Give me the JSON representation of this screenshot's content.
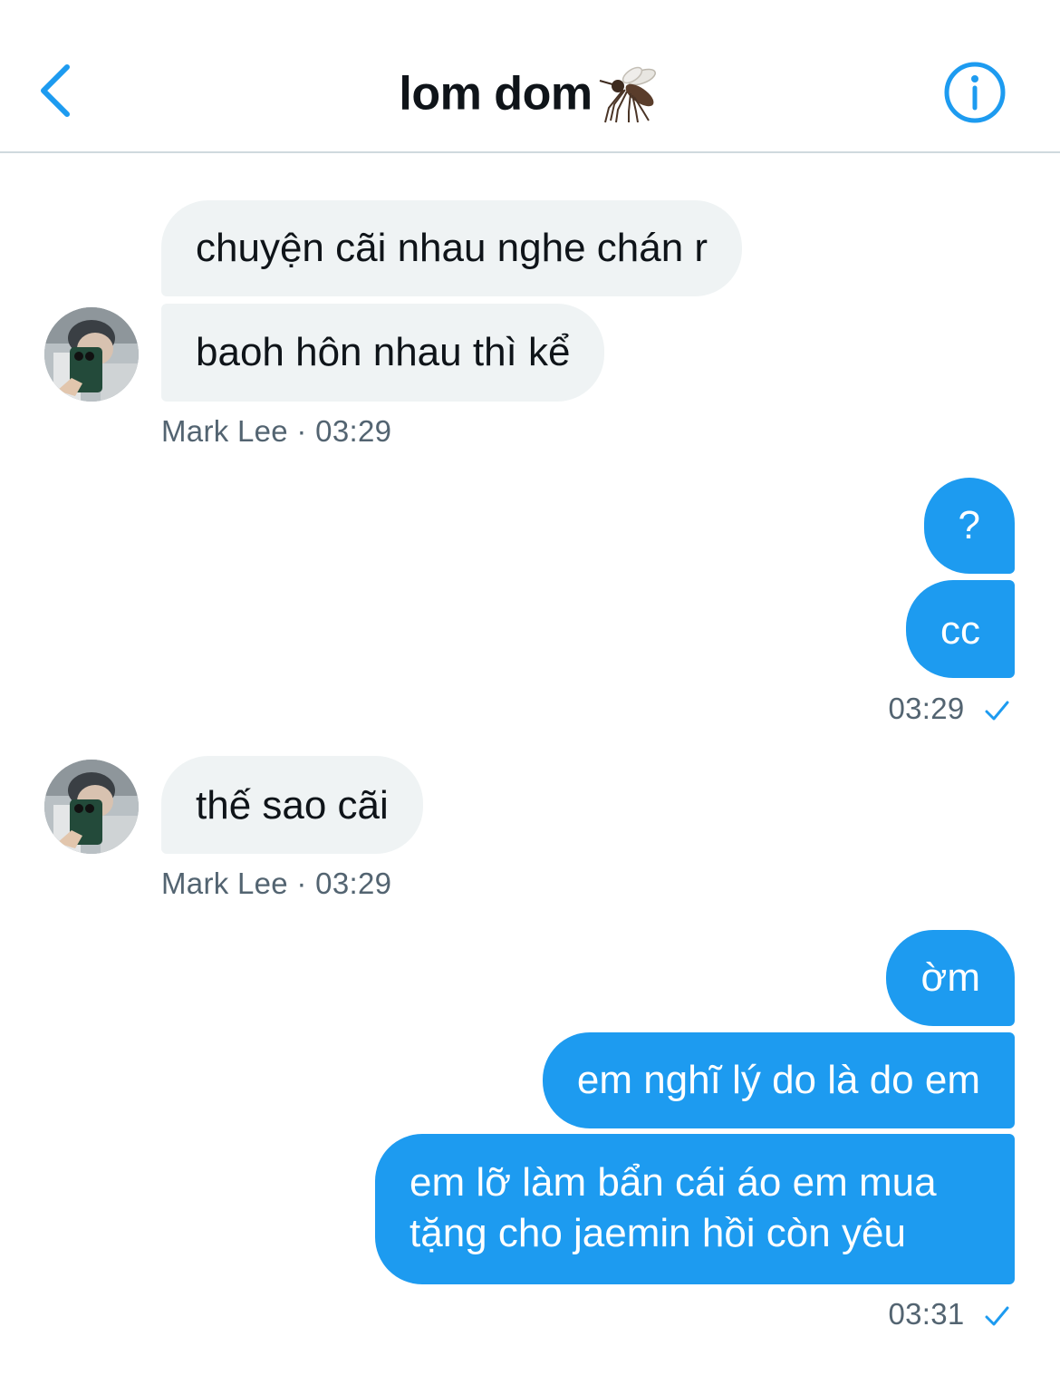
{
  "header": {
    "title": "lom dom",
    "title_emoji_icon": "mosquito-icon",
    "back_icon": "chevron-left-icon",
    "info_icon": "info-circle-icon",
    "accent_color": "#1d9bf0"
  },
  "messages": [
    {
      "group": "incoming",
      "sender": "Mark Lee",
      "bubbles": [
        "chuyện cãi nhau nghe chán r",
        "baoh hôn nhau thì kể"
      ],
      "meta": "Mark Lee · 03:29"
    },
    {
      "group": "outgoing",
      "bubbles": [
        "?",
        "cc"
      ],
      "meta": "03:29"
    },
    {
      "group": "incoming",
      "sender": "Mark Lee",
      "bubbles": [
        "thế sao cãi"
      ],
      "meta": "Mark Lee · 03:29"
    },
    {
      "group": "outgoing",
      "bubbles": [
        "ờm",
        "em nghĩ lý do là do em",
        "em lỡ làm bẩn cái áo em mua tặng cho jaemin hồi còn yêu"
      ],
      "meta": "03:31"
    }
  ],
  "colors": {
    "incoming_bubble": "#eff3f4",
    "outgoing_bubble": "#1d9bf0",
    "meta_text": "#536471"
  }
}
